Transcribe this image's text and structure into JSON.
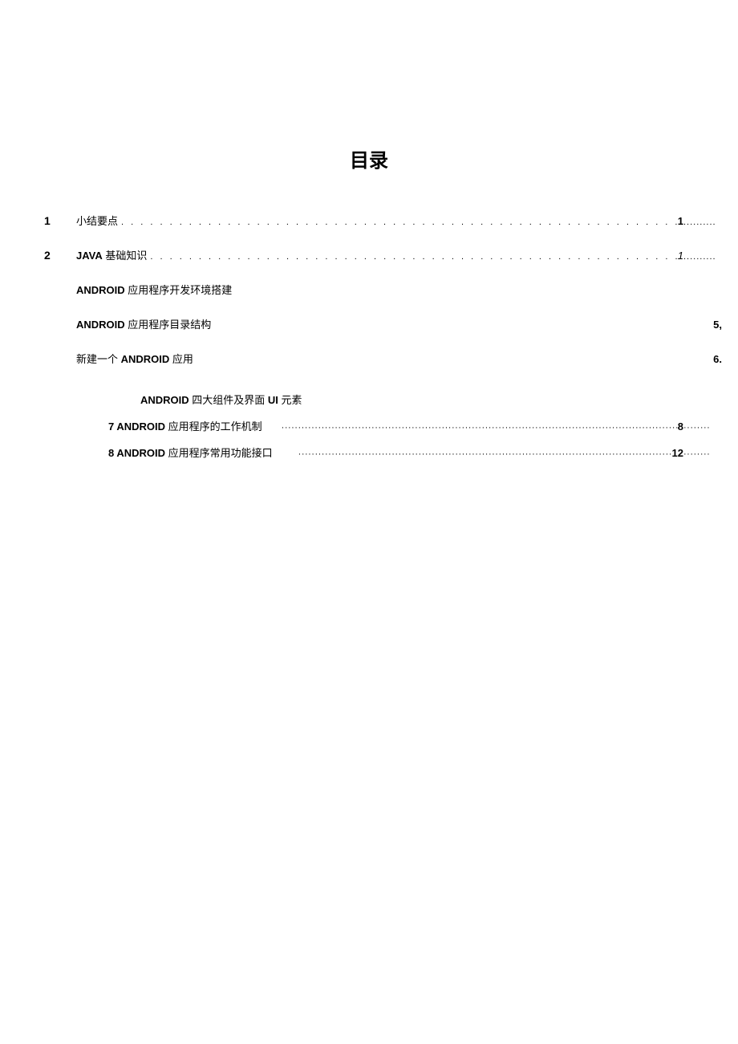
{
  "title": "目录",
  "entries": {
    "e1": {
      "num": "1",
      "label_plain": "小结要点",
      "page": "1"
    },
    "e2": {
      "num": "2",
      "label_bold": "JAVA",
      "label_plain": " 基础知识",
      "page": "1"
    },
    "e3": {
      "label_bold": "ANDROID",
      "label_plain": " 应用程序开发环境搭建"
    },
    "e4": {
      "label_bold": "ANDROID",
      "label_plain": " 应用程序目录结构",
      "page": "5,"
    },
    "e5": {
      "label_plain_a": "新建一个 ",
      "label_bold": "ANDROID",
      "label_plain_b": " 应用",
      "page": "6."
    },
    "e6": {
      "label_bold": "ANDROID",
      "label_plain": " 四大组件及界面 ",
      "label_bold_b": "UI",
      "label_plain_b": " 元素"
    },
    "e7": {
      "label_bold": "7 ANDROID",
      "label_plain": " 应用程序的工作机制",
      "page": "8"
    },
    "e8": {
      "label_bold": "8 ANDROID",
      "label_plain": " 应用程序常用功能接口",
      "page": "12"
    }
  },
  "dots_sparse": ". . . . . . . . . . . . . . . . . . . . . . . . . . . . . . . . . . . . . . . . . . . . . . . . . . . . . . . . . . . . . . . . . . . . . . . . . . . . . . . . . . . . . . . . . . . . . . . . . . . . . . . . . . . . . . . . . . . . . . . . . . . .",
  "dots_dense": "·······································································································································································································································································",
  "dots_trail": "..........",
  "dots_trail_dense": "········"
}
